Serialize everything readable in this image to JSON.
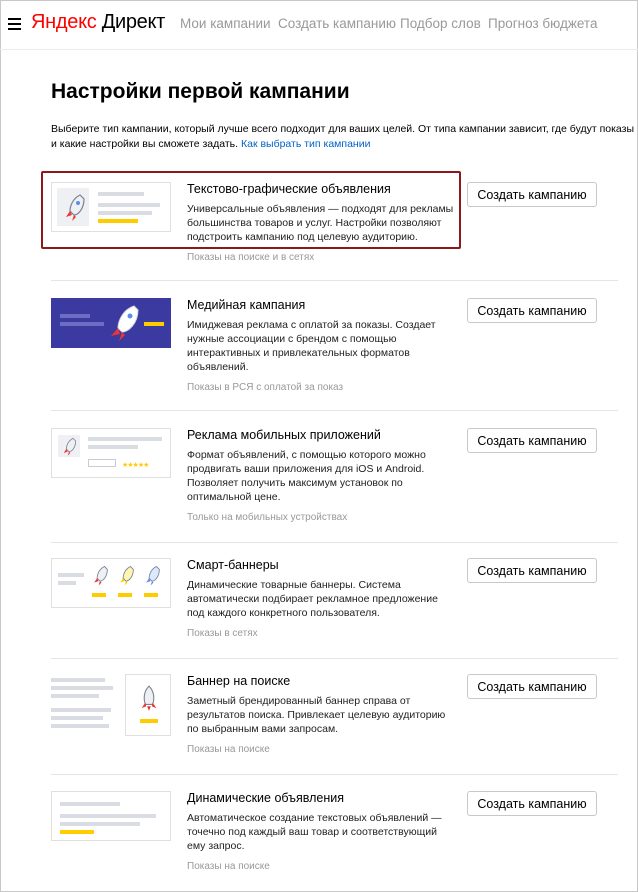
{
  "header": {
    "logo_brand": "Яндекс",
    "logo_product": "Директ",
    "nav": [
      "Мои кампании",
      "Создать кампанию",
      "Подбор слов",
      "Прогноз бюджета"
    ]
  },
  "main": {
    "title": "Настройки первой кампании",
    "intro_text": "Выберите тип кампании, который лучше всего подходит для ваших целей. От типа кампании зависит, где будут показы и какие настройки вы сможете задать.",
    "intro_link": "Как выбрать тип кампании",
    "create_button_label": "Создать кампанию",
    "campaigns": [
      {
        "title": "Текстово-графические объявления",
        "description": "Универсальные объявления — подходят для рекламы большинства товаров и услуг. Настройки позволяют подстроить кампанию под целевую аудиторию.",
        "meta": "Показы на поиске и в сетях"
      },
      {
        "title": "Медийная кампания",
        "description": "Имиджевая реклама с оплатой за показы. Создает нужные ассоциации с брендом с помощью интерактивных и привлекательных форматов объявлений.",
        "meta": "Показы в РСЯ с оплатой за показ"
      },
      {
        "title": "Реклама мобильных приложений",
        "description": "Формат объявлений, с помощью которого можно продвигать ваши приложения для iOS и Android. Позволяет получить максимум установок по оптимальной цене.",
        "meta": "Только на мобильных устройствах"
      },
      {
        "title": "Смарт-баннеры",
        "description": "Динамические товарные баннеры. Система автоматически подбирает рекламное предложение под каждого конкретного пользователя.",
        "meta": "Показы в сетях"
      },
      {
        "title": "Баннер на поиске",
        "description": "Заметный брендированный баннер справа от результатов поиска. Привлекает целевую аудиторию по выбранным вами запросам.",
        "meta": "Показы на поиске"
      },
      {
        "title": "Динамические объявления",
        "description": "Автоматическое создание текстовых объявлений — точечно под каждый ваш товар и соответствующий ему запрос.",
        "meta": "Показы на поиске"
      }
    ]
  },
  "colors": {
    "brand_red": "#ff0000",
    "link_blue": "#0064c8",
    "accent_yellow": "#ffcc00",
    "media_purple": "#3b3aa0",
    "highlight_border": "#8b1a1a"
  }
}
